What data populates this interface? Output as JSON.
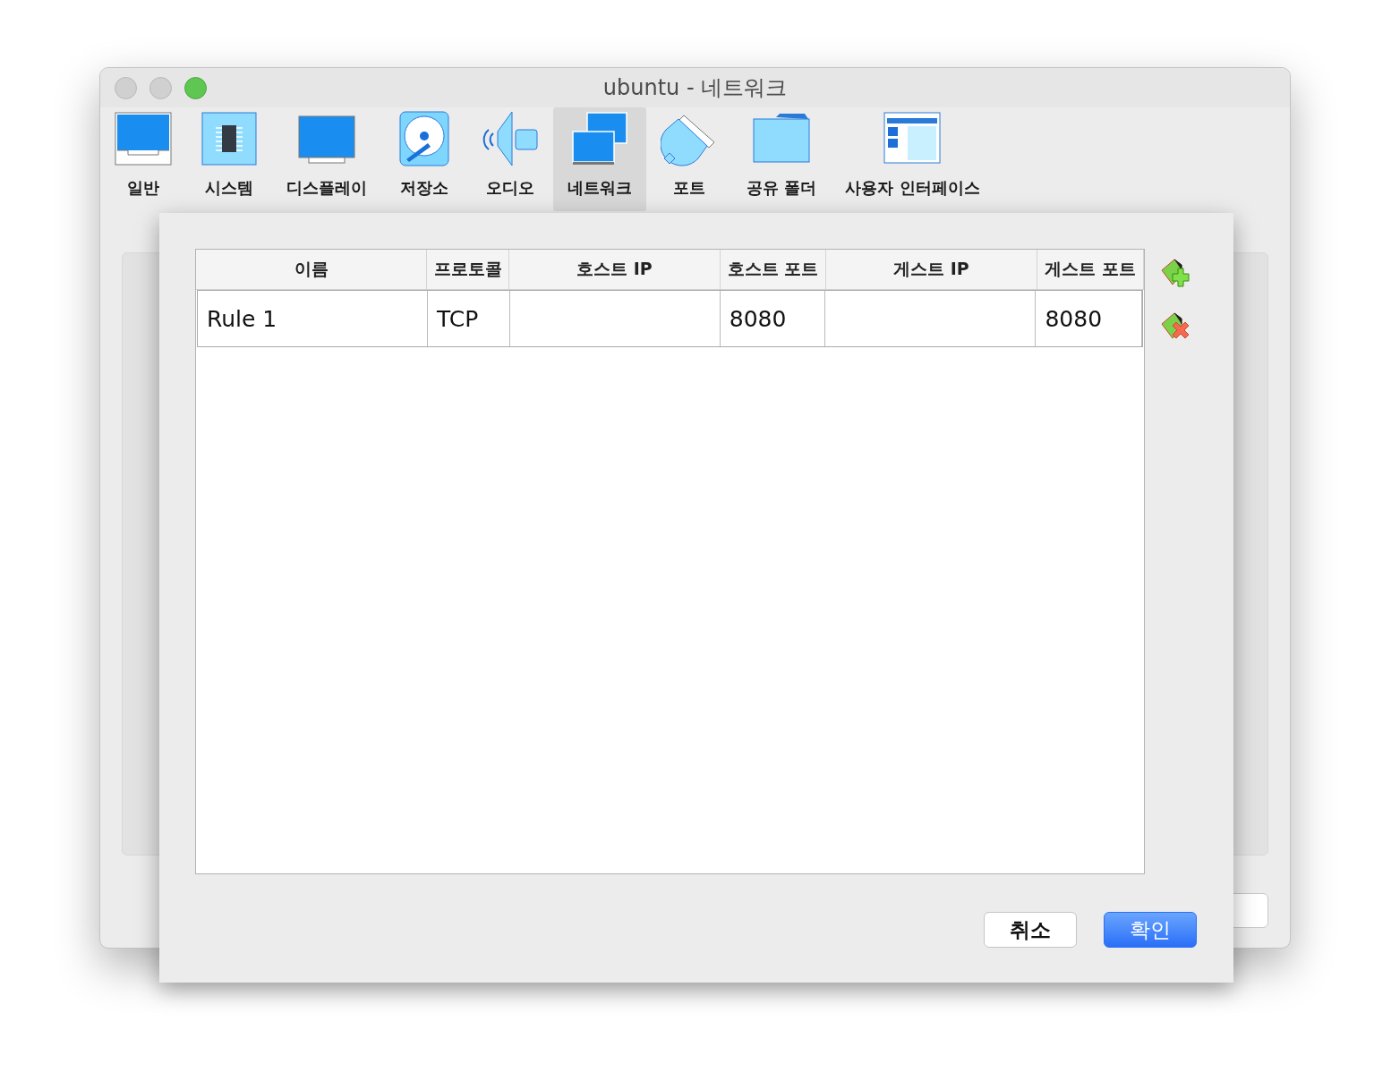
{
  "window": {
    "title": "ubuntu - 네트워크"
  },
  "tabs": [
    {
      "label": "일반",
      "kind": "monitor",
      "selected": false
    },
    {
      "label": "시스템",
      "kind": "chip",
      "selected": false
    },
    {
      "label": "디스플레이",
      "kind": "display",
      "selected": false
    },
    {
      "label": "저장소",
      "kind": "disk",
      "selected": false
    },
    {
      "label": "오디오",
      "kind": "speaker",
      "selected": false
    },
    {
      "label": "네트워크",
      "kind": "network",
      "selected": true
    },
    {
      "label": "포트",
      "kind": "port",
      "selected": false
    },
    {
      "label": "공유 폴더",
      "kind": "folder",
      "selected": false
    },
    {
      "label": "사용자 인터페이스",
      "kind": "ui",
      "selected": false
    }
  ],
  "table": {
    "columns": [
      "이름",
      "프로토콜",
      "호스트 IP",
      "호스트 포트",
      "게스트 IP",
      "게스트 포트"
    ],
    "rows": [
      [
        "Rule 1",
        "TCP",
        "",
        "8080",
        "",
        "8080"
      ]
    ]
  },
  "buttons": [
    {
      "label": "취소",
      "kind": "default"
    },
    {
      "label": "확인",
      "kind": "primary"
    }
  ]
}
